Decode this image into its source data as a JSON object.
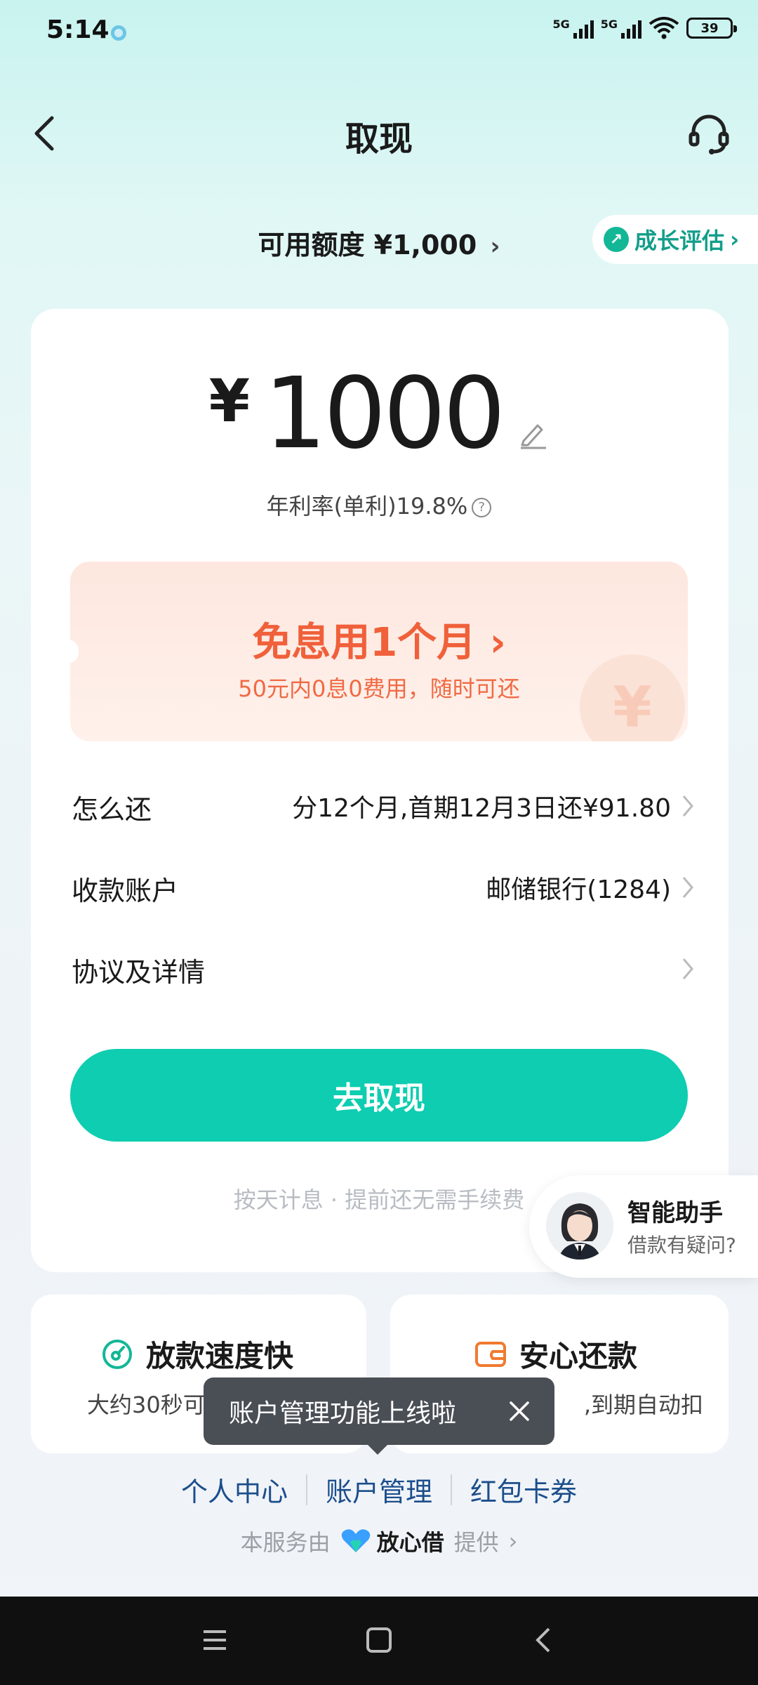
{
  "status": {
    "time": "5:14",
    "sig1": "5G",
    "sig2": "5G",
    "battery": "39"
  },
  "header": {
    "title": "取现"
  },
  "quota": {
    "text": "可用额度 ¥1,000",
    "growth": "成长评估"
  },
  "amount": {
    "currency": "¥",
    "value": "1000",
    "rate": "年利率(单利)19.8%"
  },
  "promo": {
    "title": "免息用1个月",
    "subtitle": "50元内0息0费用，随时可还",
    "coin": "¥"
  },
  "rows": [
    {
      "label": "怎么还",
      "value": "分12个月,首期12月3日还¥91.80"
    },
    {
      "label": "收款账户",
      "value": "邮储银行(1284)"
    },
    {
      "label": "协议及详情",
      "value": ""
    }
  ],
  "cta": {
    "label": "去取现"
  },
  "hint": "按天计息 · 提前还无需手续费",
  "assistant": {
    "title": "智能助手",
    "subtitle": "借款有疑问?"
  },
  "features": [
    {
      "title": "放款速度快",
      "subtitle": "大约30秒可",
      "color": "#13b796"
    },
    {
      "title": "安心还款",
      "subtitle": ",到期自动扣",
      "color": "#f07a30"
    }
  ],
  "toast": {
    "text": "账户管理功能上线啦"
  },
  "links": [
    "个人中心",
    "账户管理",
    "红包卡券"
  ],
  "provider": {
    "prefix": "本服务由",
    "brand": "放心借",
    "suffix": "提供"
  }
}
